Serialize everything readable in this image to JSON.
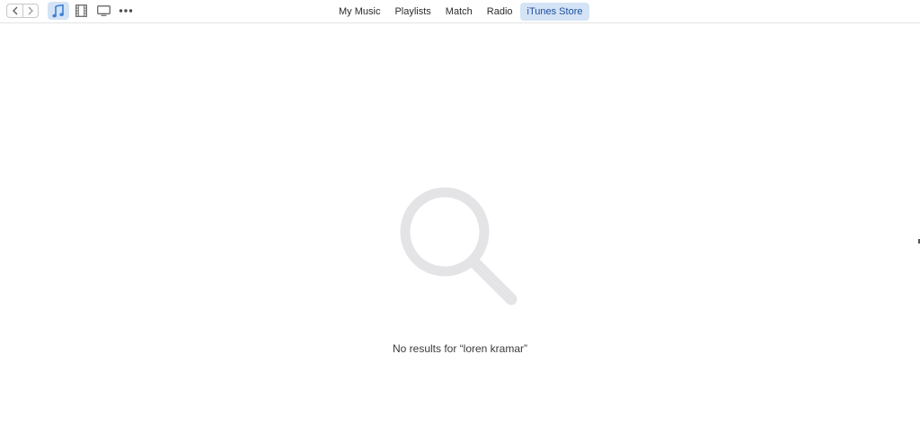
{
  "toolbar": {
    "nav": {
      "back_icon": "chevron-left-icon",
      "forward_icon": "chevron-right-icon"
    },
    "media_types": [
      {
        "icon": "music-note-icon",
        "active": true
      },
      {
        "icon": "film-icon",
        "active": false
      },
      {
        "icon": "tv-icon",
        "active": false
      },
      {
        "icon": "more-icon",
        "active": false
      }
    ],
    "tabs": [
      {
        "label": "My Music",
        "active": false
      },
      {
        "label": "Playlists",
        "active": false
      },
      {
        "label": "Match",
        "active": false
      },
      {
        "label": "Radio",
        "active": false
      },
      {
        "label": "iTunes Store",
        "active": true
      }
    ]
  },
  "main": {
    "empty_state_icon": "magnifying-glass-icon",
    "message": "No results for “loren kramar”"
  },
  "colors": {
    "accent": "#d4e3f5",
    "accent_text": "#1f4e9e",
    "icon_blue": "#3d7fd6",
    "empty_icon_gray": "#e4e4e7"
  }
}
